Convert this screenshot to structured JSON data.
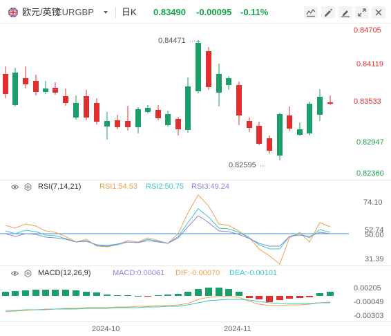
{
  "header": {
    "symbol_name": "欧元/英镑",
    "symbol_code": "EURGBP",
    "period": "日K",
    "price": "0.83490",
    "change": "-0.00095",
    "change_pct": "-0.11%"
  },
  "toolbar": {
    "icons": [
      "chart-type-icon",
      "draw-icon",
      "edit-icon",
      "fullscreen-icon",
      "close-icon"
    ]
  },
  "main_axis": [
    "0.84705",
    "0.84119",
    "0.83533",
    "0.82947",
    "0.82360"
  ],
  "annotations": {
    "high": "0.84471",
    "low": "0.82595"
  },
  "rsi": {
    "title": "RSI(7,14,21)",
    "rsi1": "RSI1:54.53",
    "rsi2": "RSI2:50.75",
    "rsi3": "RSI3:49.24",
    "axis": [
      "74.10",
      "52.74",
      "50.00",
      "31.39"
    ]
  },
  "macd": {
    "title": "MACD(12,26,9)",
    "macd": "MACD:0.00061",
    "dif": "DIF:-0.00070",
    "dea": "DEA:-0.00101",
    "axis": [
      "0.00205",
      "-0.00049",
      "-0.00303"
    ]
  },
  "x_axis": [
    "2024-10",
    "2024-11"
  ],
  "colors": {
    "up": "#e02f2f",
    "down": "#1a9e6a",
    "change": "#17a34a",
    "rsi1": "#f0a050",
    "rsi2": "#3cc7c7",
    "rsi3": "#8a86e0",
    "ref_line": "#3f8fd6",
    "dif": "#f0a050",
    "dea": "#3cc7c7"
  }
}
